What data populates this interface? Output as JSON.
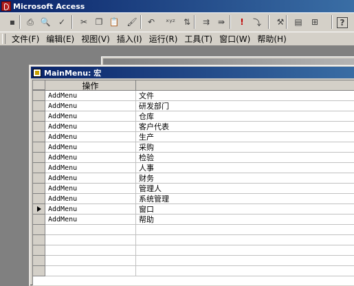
{
  "app": {
    "title": "Microsoft Access"
  },
  "toolbar": {
    "buttons": [
      {
        "name": "save-icon",
        "glyph": "▪"
      },
      {
        "name": "print-icon",
        "glyph": "⎙"
      },
      {
        "name": "print-preview-icon",
        "glyph": "🔍"
      },
      {
        "name": "spelling-icon",
        "glyph": "✓"
      },
      {
        "name": "cut-icon",
        "glyph": "✂"
      },
      {
        "name": "copy-icon",
        "glyph": "❐"
      },
      {
        "name": "paste-icon",
        "glyph": "📋"
      },
      {
        "name": "format-painter-icon",
        "glyph": "🖌"
      },
      {
        "name": "undo-icon",
        "glyph": "↶"
      },
      {
        "name": "macro-names-icon",
        "glyph": "ˣʸᶻ"
      },
      {
        "name": "conditions-icon",
        "glyph": "⇅"
      },
      {
        "name": "insert-rows-icon",
        "glyph": "⇉"
      },
      {
        "name": "delete-rows-icon",
        "glyph": "⇛"
      },
      {
        "name": "run-icon",
        "glyph": "!"
      },
      {
        "name": "step-icon",
        "glyph": "⤵"
      },
      {
        "name": "build-icon",
        "glyph": "⚒"
      },
      {
        "name": "database-window-icon",
        "glyph": "▤"
      },
      {
        "name": "new-object-icon",
        "glyph": "⊞"
      },
      {
        "name": "help-icon",
        "glyph": "?"
      }
    ]
  },
  "menu": {
    "items": [
      {
        "label": "文件(F)"
      },
      {
        "label": "编辑(E)"
      },
      {
        "label": "视图(V)"
      },
      {
        "label": "插入(I)"
      },
      {
        "label": "运行(R)"
      },
      {
        "label": "工具(T)"
      },
      {
        "label": "窗口(W)"
      },
      {
        "label": "帮助(H)"
      }
    ]
  },
  "background_window": {
    "title": ""
  },
  "macro_window": {
    "title": "MainMenu: 宏",
    "column_header": "操作",
    "rows": [
      {
        "action": "AddMenu",
        "comment": "文件"
      },
      {
        "action": "AddMenu",
        "comment": "研发部门"
      },
      {
        "action": "AddMenu",
        "comment": "仓库"
      },
      {
        "action": "AddMenu",
        "comment": "客户代表"
      },
      {
        "action": "AddMenu",
        "comment": "生产"
      },
      {
        "action": "AddMenu",
        "comment": "采购"
      },
      {
        "action": "AddMenu",
        "comment": "检验"
      },
      {
        "action": "AddMenu",
        "comment": "人事"
      },
      {
        "action": "AddMenu",
        "comment": "财务"
      },
      {
        "action": "AddMenu",
        "comment": "管理人"
      },
      {
        "action": "AddMenu",
        "comment": "系统管理"
      },
      {
        "action": "AddMenu",
        "comment": "窗口"
      },
      {
        "action": "AddMenu",
        "comment": "帮助"
      },
      {
        "action": "",
        "comment": ""
      },
      {
        "action": "",
        "comment": ""
      },
      {
        "action": "",
        "comment": ""
      },
      {
        "action": "",
        "comment": ""
      },
      {
        "action": "",
        "comment": ""
      }
    ],
    "current_row_index": 11
  }
}
